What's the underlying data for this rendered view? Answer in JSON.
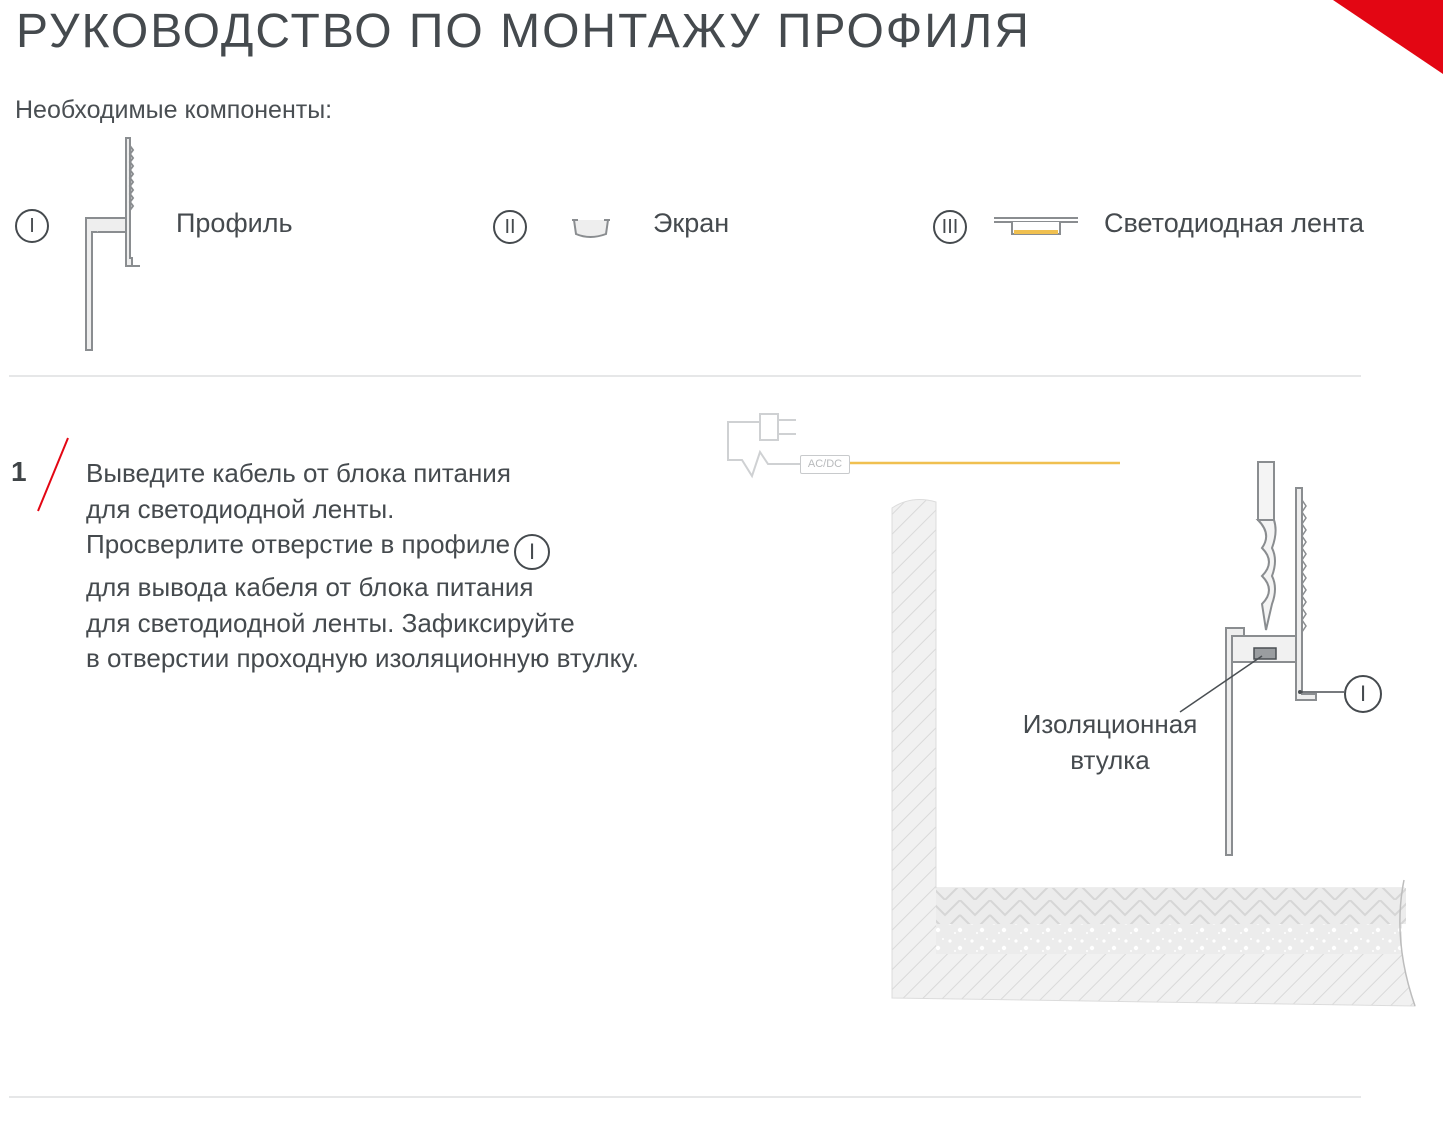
{
  "header": {
    "title": "РУКОВОДСТВО ПО МОНТАЖУ ПРОФИЛЯ",
    "accent_color": "#e30613"
  },
  "components": {
    "heading": "Необходимые компоненты:",
    "items": [
      {
        "numeral": "I",
        "label": "Профиль",
        "icon": "profile-icon"
      },
      {
        "numeral": "II",
        "label": "Экран",
        "icon": "diffuser-screen-icon"
      },
      {
        "numeral": "III",
        "label": "Светодиодная лента",
        "icon": "led-strip-icon"
      }
    ]
  },
  "step": {
    "number": "1",
    "lines": [
      "Выведите кабель от блока питания",
      "для светодиодной ленты.",
      "Просверлите отверстие в профиле",
      "для вывода кабеля от блока питания",
      "для светодиодной ленты. Зафиксируйте",
      "в отверстии проходную изоляционную втулку."
    ],
    "inline_ref": "I"
  },
  "diagram": {
    "power_label": "AC/DC",
    "callout_label_line1": "Изоляционная",
    "callout_label_line2": "втулка",
    "profile_ref": "I",
    "cable_color": "#f0c050"
  }
}
